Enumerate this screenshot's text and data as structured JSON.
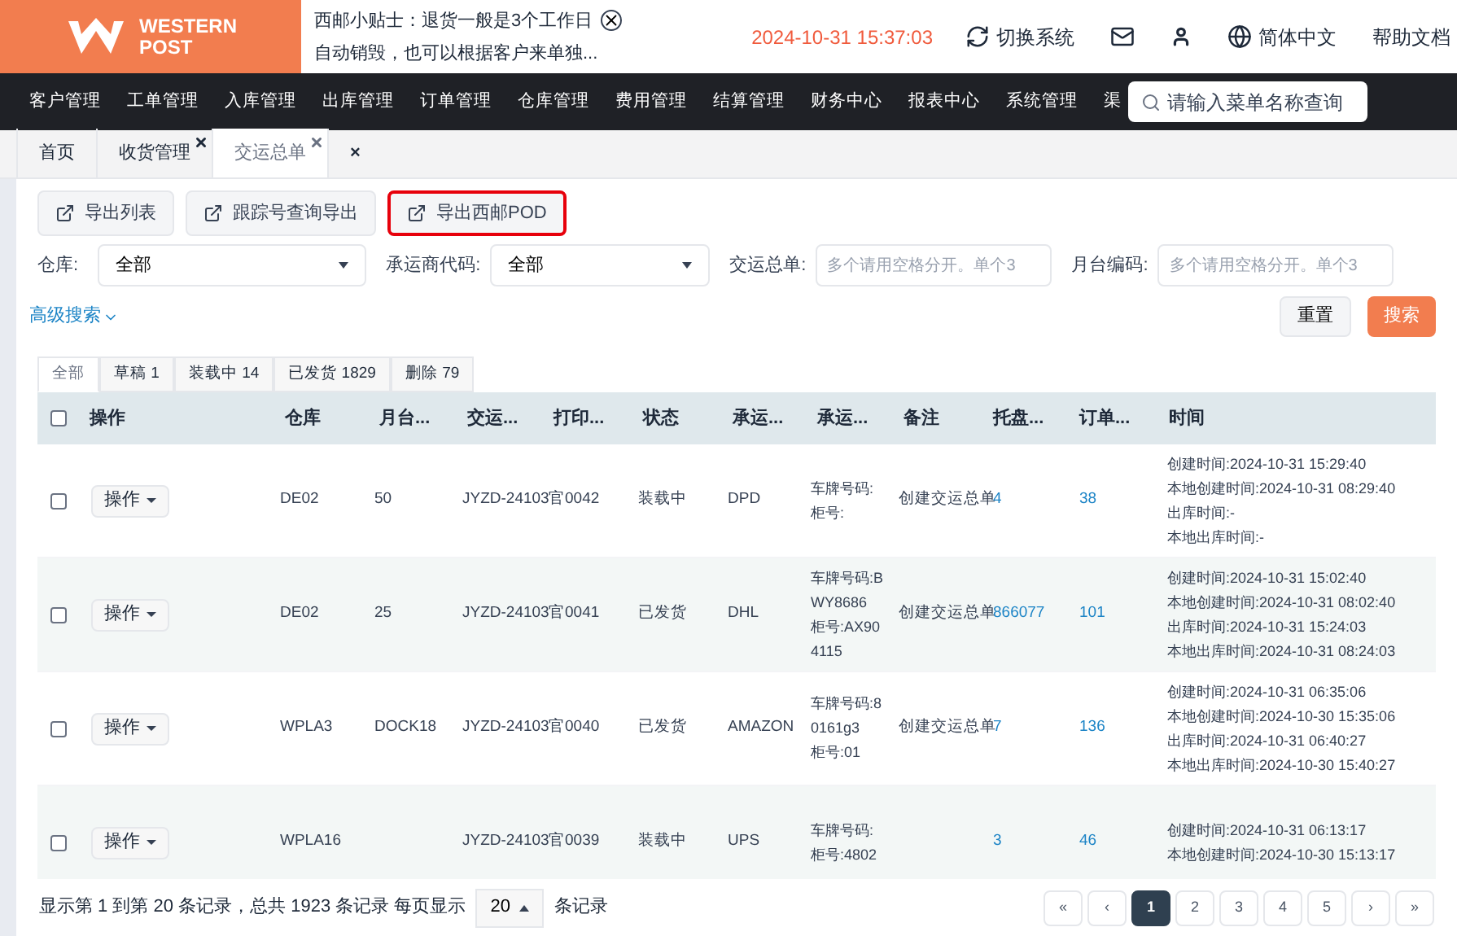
{
  "logo": {
    "line1": "WESTERN",
    "line2": "POST"
  },
  "notice": {
    "line1": "西邮小贴士：退货一般是3个工作日",
    "line2": "自动销毁，也可以根据客户来单独..."
  },
  "clock": "2024-10-31 15:37:03",
  "header_links": [
    {
      "kind": "switch",
      "label": "切换系统"
    },
    {
      "kind": "mail"
    },
    {
      "kind": "user"
    },
    {
      "kind": "globe",
      "label": "简体中文"
    },
    {
      "kind": "plain",
      "label": "帮助文档"
    }
  ],
  "menu": [
    "客户管理",
    "工单管理",
    "入库管理",
    "出库管理",
    "订单管理",
    "仓库管理",
    "费用管理",
    "结算管理",
    "财务中心",
    "报表中心",
    "系统管理",
    "渠"
  ],
  "menu_search": {
    "placeholder": "请输入菜单名称查询"
  },
  "page_tabs": [
    {
      "label": "首页",
      "selected": false,
      "closable": false
    },
    {
      "label": "收货管理",
      "selected": false,
      "closable": true
    },
    {
      "label": "交运总单",
      "selected": true,
      "closable": true
    },
    {
      "label": "×",
      "selected": false,
      "closable": false
    }
  ],
  "toolbar": [
    {
      "label": "导出列表",
      "highlighted": false
    },
    {
      "label": "跟踪号查询导出",
      "highlighted": false
    },
    {
      "label": "导出西邮POD",
      "highlighted": true
    }
  ],
  "filters": [
    {
      "kind": "select",
      "label": "仓库:",
      "value": "全部"
    },
    {
      "kind": "select",
      "label": "承运商代码:",
      "value": "全部"
    },
    {
      "kind": "input",
      "label": "交运总单:",
      "placeholder": "多个请用空格分开。单个3"
    },
    {
      "kind": "input",
      "label": "月台编码:",
      "placeholder": "多个请用空格分开。单个3"
    }
  ],
  "advanced": "高级搜索",
  "actions": {
    "reset": "重置",
    "search": "搜索"
  },
  "status_tabs": [
    {
      "label": "全部",
      "selected": true
    },
    {
      "label": "草稿 1",
      "selected": false
    },
    {
      "label": "装载中 14",
      "selected": false
    },
    {
      "label": "已发货 1829",
      "selected": false
    },
    {
      "label": "删除 79",
      "selected": false
    }
  ],
  "table": {
    "all_checked": false,
    "columns": [
      "操作",
      "仓库",
      "月台...",
      "交运...",
      "打印...",
      "状态",
      "承运...",
      "承运...",
      "备注",
      "托盘...",
      "订单...",
      "时间"
    ],
    "rows": [
      {
        "checked": false,
        "action": "操作",
        "warehouse": "DE02",
        "dock": "50",
        "order": "JYZD-24103",
        "print": "官0042",
        "status": "装载中",
        "carrier": "DPD",
        "vehicle": [
          "车牌号码:",
          "柜号:"
        ],
        "remark": "创建交运总单",
        "pallets": "4",
        "orders": "38",
        "times": [
          "创建时间:2024-10-31 15:29:40",
          "本地创建时间:2024-10-31 08:29:40",
          "出库时间:-",
          "本地出库时间:-"
        ]
      },
      {
        "checked": false,
        "action": "操作",
        "warehouse": "DE02",
        "dock": "25",
        "order": "JYZD-24103",
        "print": "官0041",
        "status": "已发货",
        "carrier": "DHL",
        "vehicle": [
          "车牌号码:B",
          "WY8686",
          "柜号:AX90",
          "4115"
        ],
        "remark": "创建交运总单",
        "pallets": "866077",
        "orders": "101",
        "times": [
          "创建时间:2024-10-31 15:02:40",
          "本地创建时间:2024-10-31 08:02:40",
          "出库时间:2024-10-31 15:24:03",
          "本地出库时间:2024-10-31 08:24:03"
        ]
      },
      {
        "checked": false,
        "action": "操作",
        "warehouse": "WPLA3",
        "dock": "DOCK18",
        "order": "JYZD-24103",
        "print": "官0040",
        "status": "已发货",
        "carrier": "AMAZON",
        "vehicle": [
          "车牌号码:8",
          "0161g3",
          "柜号:01"
        ],
        "remark": "创建交运总单",
        "pallets": "7",
        "orders": "136",
        "times": [
          "创建时间:2024-10-31 06:35:06",
          "本地创建时间:2024-10-30 15:35:06",
          "出库时间:2024-10-31 06:40:27",
          "本地出库时间:2024-10-30 15:40:27"
        ]
      },
      {
        "checked": false,
        "action": "操作",
        "warehouse": "WPLA16",
        "dock": "",
        "order": "JYZD-24103",
        "print": "官0039",
        "status": "装载中",
        "carrier": "UPS",
        "vehicle": [
          "车牌号码:",
          "柜号:4802"
        ],
        "remark": "",
        "pallets": "3",
        "orders": "46",
        "times": [
          "创建时间:2024-10-31 06:13:17",
          "本地创建时间:2024-10-30 15:13:17"
        ]
      }
    ]
  },
  "footer": {
    "summary": "显示第 1 到第 20 条记录，总共 1923 条记录 每页显示",
    "page_size": "20",
    "suffix": "条记录"
  },
  "pagination": [
    {
      "label": "«",
      "selected": false
    },
    {
      "label": "‹",
      "selected": false
    },
    {
      "label": "1",
      "selected": true
    },
    {
      "label": "2",
      "selected": false
    },
    {
      "label": "3",
      "selected": false
    },
    {
      "label": "4",
      "selected": false
    },
    {
      "label": "5",
      "selected": false
    },
    {
      "label": "›",
      "selected": false
    },
    {
      "label": "»",
      "selected": false
    }
  ]
}
